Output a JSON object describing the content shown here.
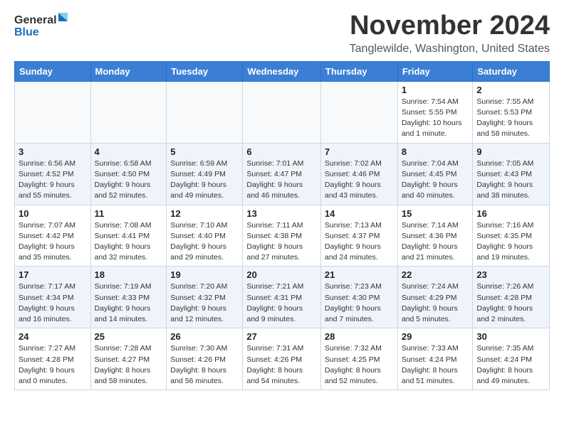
{
  "header": {
    "logo_general": "General",
    "logo_blue": "Blue",
    "title": "November 2024",
    "location": "Tanglewilde, Washington, United States"
  },
  "days_of_week": [
    "Sunday",
    "Monday",
    "Tuesday",
    "Wednesday",
    "Thursday",
    "Friday",
    "Saturday"
  ],
  "weeks": [
    [
      {
        "day": "",
        "detail": ""
      },
      {
        "day": "",
        "detail": ""
      },
      {
        "day": "",
        "detail": ""
      },
      {
        "day": "",
        "detail": ""
      },
      {
        "day": "",
        "detail": ""
      },
      {
        "day": "1",
        "detail": "Sunrise: 7:54 AM\nSunset: 5:55 PM\nDaylight: 10 hours and 1 minute."
      },
      {
        "day": "2",
        "detail": "Sunrise: 7:55 AM\nSunset: 5:53 PM\nDaylight: 9 hours and 58 minutes."
      }
    ],
    [
      {
        "day": "3",
        "detail": "Sunrise: 6:56 AM\nSunset: 4:52 PM\nDaylight: 9 hours and 55 minutes."
      },
      {
        "day": "4",
        "detail": "Sunrise: 6:58 AM\nSunset: 4:50 PM\nDaylight: 9 hours and 52 minutes."
      },
      {
        "day": "5",
        "detail": "Sunrise: 6:59 AM\nSunset: 4:49 PM\nDaylight: 9 hours and 49 minutes."
      },
      {
        "day": "6",
        "detail": "Sunrise: 7:01 AM\nSunset: 4:47 PM\nDaylight: 9 hours and 46 minutes."
      },
      {
        "day": "7",
        "detail": "Sunrise: 7:02 AM\nSunset: 4:46 PM\nDaylight: 9 hours and 43 minutes."
      },
      {
        "day": "8",
        "detail": "Sunrise: 7:04 AM\nSunset: 4:45 PM\nDaylight: 9 hours and 40 minutes."
      },
      {
        "day": "9",
        "detail": "Sunrise: 7:05 AM\nSunset: 4:43 PM\nDaylight: 9 hours and 38 minutes."
      }
    ],
    [
      {
        "day": "10",
        "detail": "Sunrise: 7:07 AM\nSunset: 4:42 PM\nDaylight: 9 hours and 35 minutes."
      },
      {
        "day": "11",
        "detail": "Sunrise: 7:08 AM\nSunset: 4:41 PM\nDaylight: 9 hours and 32 minutes."
      },
      {
        "day": "12",
        "detail": "Sunrise: 7:10 AM\nSunset: 4:40 PM\nDaylight: 9 hours and 29 minutes."
      },
      {
        "day": "13",
        "detail": "Sunrise: 7:11 AM\nSunset: 4:38 PM\nDaylight: 9 hours and 27 minutes."
      },
      {
        "day": "14",
        "detail": "Sunrise: 7:13 AM\nSunset: 4:37 PM\nDaylight: 9 hours and 24 minutes."
      },
      {
        "day": "15",
        "detail": "Sunrise: 7:14 AM\nSunset: 4:36 PM\nDaylight: 9 hours and 21 minutes."
      },
      {
        "day": "16",
        "detail": "Sunrise: 7:16 AM\nSunset: 4:35 PM\nDaylight: 9 hours and 19 minutes."
      }
    ],
    [
      {
        "day": "17",
        "detail": "Sunrise: 7:17 AM\nSunset: 4:34 PM\nDaylight: 9 hours and 16 minutes."
      },
      {
        "day": "18",
        "detail": "Sunrise: 7:19 AM\nSunset: 4:33 PM\nDaylight: 9 hours and 14 minutes."
      },
      {
        "day": "19",
        "detail": "Sunrise: 7:20 AM\nSunset: 4:32 PM\nDaylight: 9 hours and 12 minutes."
      },
      {
        "day": "20",
        "detail": "Sunrise: 7:21 AM\nSunset: 4:31 PM\nDaylight: 9 hours and 9 minutes."
      },
      {
        "day": "21",
        "detail": "Sunrise: 7:23 AM\nSunset: 4:30 PM\nDaylight: 9 hours and 7 minutes."
      },
      {
        "day": "22",
        "detail": "Sunrise: 7:24 AM\nSunset: 4:29 PM\nDaylight: 9 hours and 5 minutes."
      },
      {
        "day": "23",
        "detail": "Sunrise: 7:26 AM\nSunset: 4:28 PM\nDaylight: 9 hours and 2 minutes."
      }
    ],
    [
      {
        "day": "24",
        "detail": "Sunrise: 7:27 AM\nSunset: 4:28 PM\nDaylight: 9 hours and 0 minutes."
      },
      {
        "day": "25",
        "detail": "Sunrise: 7:28 AM\nSunset: 4:27 PM\nDaylight: 8 hours and 58 minutes."
      },
      {
        "day": "26",
        "detail": "Sunrise: 7:30 AM\nSunset: 4:26 PM\nDaylight: 8 hours and 56 minutes."
      },
      {
        "day": "27",
        "detail": "Sunrise: 7:31 AM\nSunset: 4:26 PM\nDaylight: 8 hours and 54 minutes."
      },
      {
        "day": "28",
        "detail": "Sunrise: 7:32 AM\nSunset: 4:25 PM\nDaylight: 8 hours and 52 minutes."
      },
      {
        "day": "29",
        "detail": "Sunrise: 7:33 AM\nSunset: 4:24 PM\nDaylight: 8 hours and 51 minutes."
      },
      {
        "day": "30",
        "detail": "Sunrise: 7:35 AM\nSunset: 4:24 PM\nDaylight: 8 hours and 49 minutes."
      }
    ]
  ]
}
